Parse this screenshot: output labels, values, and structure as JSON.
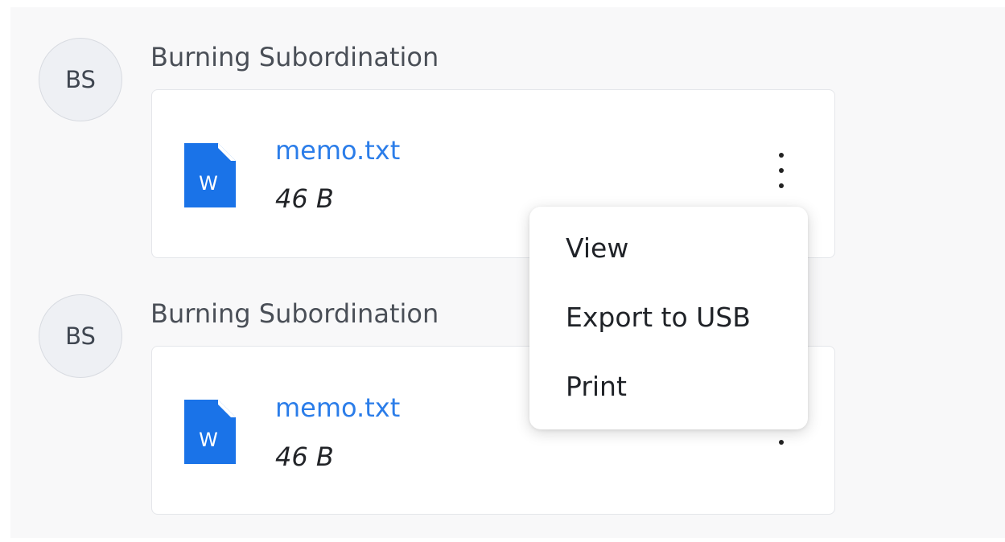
{
  "messages": [
    {
      "avatar_initials": "BS",
      "sender": "Burning Subordination",
      "attachment": {
        "icon": "word-document-icon",
        "icon_letter": "W",
        "file_name": "memo.txt",
        "file_size": "46 B"
      }
    },
    {
      "avatar_initials": "BS",
      "sender": "Burning Subordination",
      "attachment": {
        "icon": "word-document-icon",
        "icon_letter": "W",
        "file_name": "memo.txt",
        "file_size": "46 B"
      }
    }
  ],
  "context_menu": {
    "items": [
      "View",
      "Export to USB",
      "Print"
    ]
  },
  "colors": {
    "link": "#2b7de9",
    "file_icon": "#1a73e8",
    "avatar_bg": "#eef0f4",
    "panel_bg": "#f8f8f9"
  }
}
